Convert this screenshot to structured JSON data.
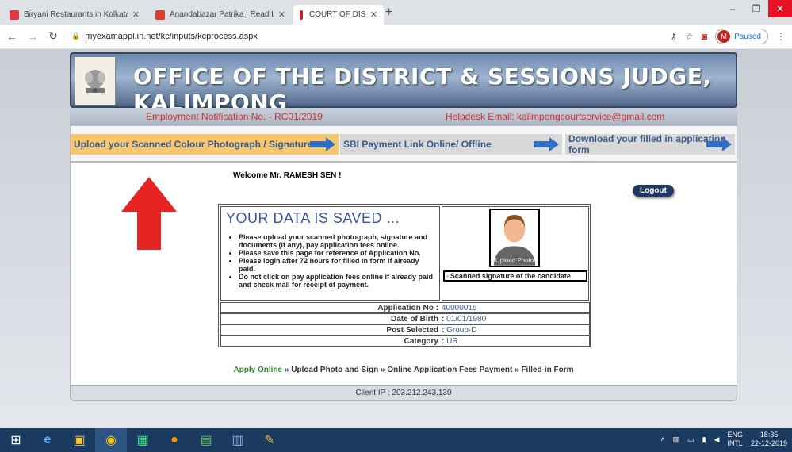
{
  "browser": {
    "tabs": [
      {
        "title": "Biryani Restaurants in Kolkata - Z",
        "favicon_color": "#e23744",
        "active": false
      },
      {
        "title": "Anandabazar Patrika | Read Latest",
        "favicon_color": "#d6402e",
        "active": false
      },
      {
        "title": "COURT OF DISTRICT & SESSION",
        "favicon_color": "#c5221f",
        "active": true
      }
    ],
    "url": "myexamappl.in.net/kc/inputs/kcprocess.aspx",
    "profile_initial": "M",
    "profile_status": "Paused"
  },
  "header": {
    "title": "OFFICE OF THE DISTRICT & SESSIONS JUDGE, KALIMPONG",
    "emblem_motto": "सत्यमेव जयते"
  },
  "info": {
    "notification": "Employment Notification No. - RC01/2019",
    "helpdesk": "Helpdesk Email: kalimpongcourtservice@gmail.com"
  },
  "steps": [
    {
      "label": "Upload your Scanned Colour Photograph / Signature"
    },
    {
      "label": "SBI Payment Link Online/ Offline"
    },
    {
      "label": "Download your filled in application form"
    }
  ],
  "welcome": "Welcome  Mr. RAMESH SEN !",
  "logout_label": "Logout",
  "saved": {
    "heading": "YOUR DATA IS SAVED ...",
    "notes": [
      "Please upload your scanned photograph, signature and documents (if any), pay application fees online.",
      "Please save this page for reference of Application No.",
      "Please login after 72 hours for filled in form if already paid.",
      "Do not click on pay application fees online if already paid and check mail for receipt of payment."
    ]
  },
  "photo_caption": "Upload Photo",
  "signature_alt": "Scanned signature of the candidate",
  "details": [
    {
      "label": "Application No :",
      "value": "40000016"
    },
    {
      "label": "Date of Birth",
      "value": "01/01/1980"
    },
    {
      "label": "Post Selected",
      "value": "Group-D"
    },
    {
      "label": "Category",
      "value": "UR"
    }
  ],
  "breadcrumb": {
    "apply": "Apply Online",
    "rest": " » Upload Photo and Sign » Online Application Fees Payment » Filled-in Form"
  },
  "client_ip": "Client IP : 203.212.243.130",
  "taskbar": {
    "lang": "ENG",
    "layout": "INTL",
    "time": "18:35",
    "date": "22-12-2019"
  },
  "colors": {
    "accent_red": "#e62424",
    "link_blue": "#3a5a8c",
    "header_blue": "#52698c"
  }
}
